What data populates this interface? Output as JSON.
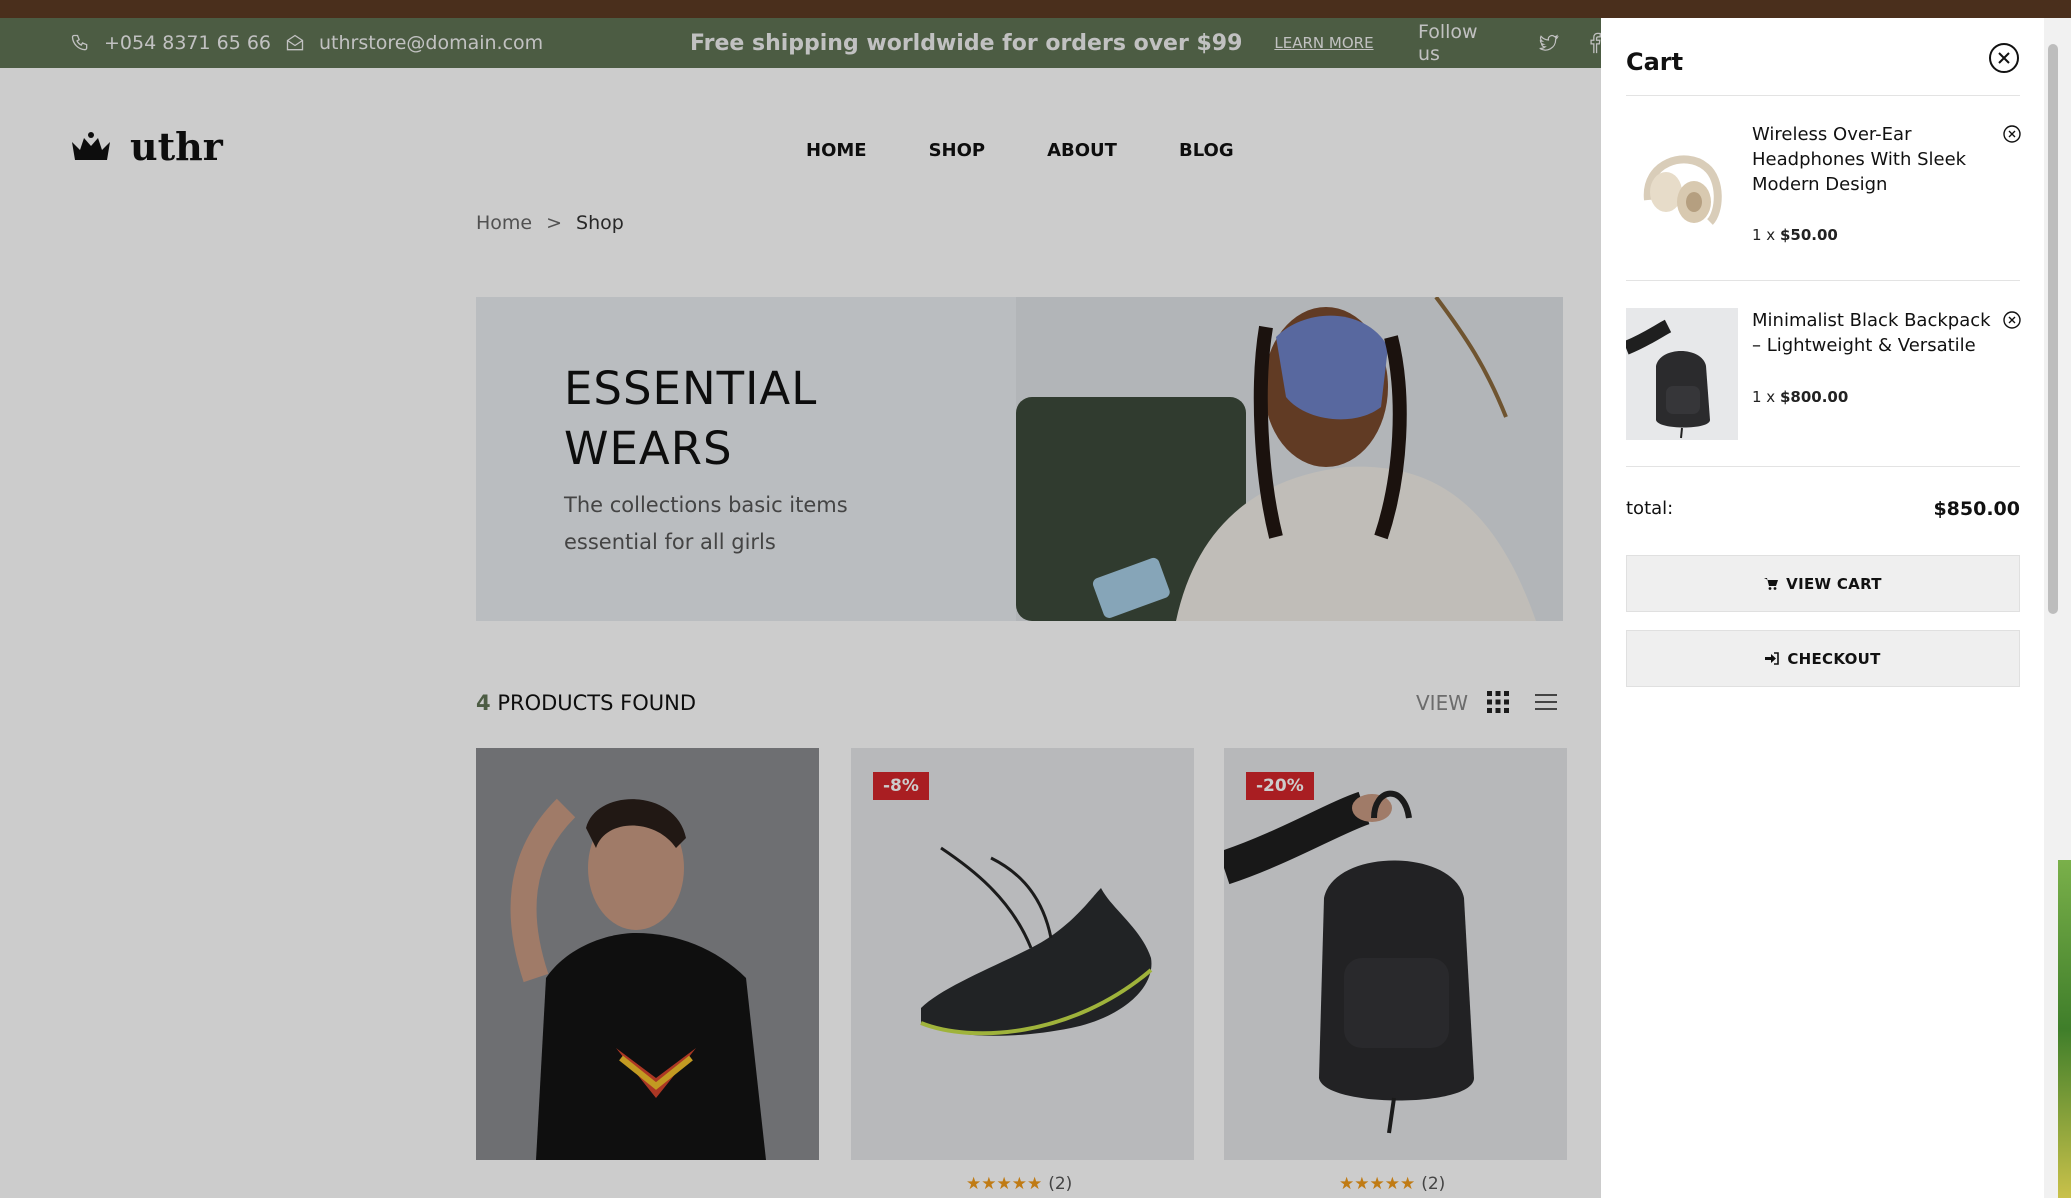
{
  "topbar": {
    "phone": "+054 8371 65 66",
    "email": "uthrstore@domain.com",
    "shipping_text": "Free shipping worldwide for orders over $99",
    "learn_more": "LEARN MORE",
    "follow_us": "Follow us"
  },
  "header": {
    "logo_text": "uthr",
    "nav": [
      "HOME",
      "SHOP",
      "ABOUT",
      "BLOG"
    ]
  },
  "breadcrumb": {
    "home": "Home",
    "sep": ">",
    "current": "Shop"
  },
  "banner": {
    "title_line1": "ESSENTIAL",
    "title_line2": "WEARS",
    "subtitle": "The collections basic items essential for all girls"
  },
  "products": {
    "count": "4",
    "found_label": "PRODUCTS FOUND",
    "view_label": "VIEW",
    "cards": [
      {
        "badge": "",
        "rating_count": ""
      },
      {
        "badge": "-8%",
        "rating_count": "(2)"
      },
      {
        "badge": "-20%",
        "rating_count": "(2)"
      }
    ]
  },
  "cart": {
    "title": "Cart",
    "items": [
      {
        "name": "Wireless Over-Ear Headphones With Sleek Modern Design",
        "qty": "1 x",
        "price": "$50.00"
      },
      {
        "name": "Minimalist Black Backpack – Lightweight & Versatile",
        "qty": "1 x",
        "price": "$800.00"
      }
    ],
    "total_label": "total:",
    "total_value": "$850.00",
    "view_cart": "VIEW CART",
    "checkout": "CHECKOUT"
  },
  "colors": {
    "topbar": "#5f7354",
    "badge": "#d4262b",
    "stars": "#f09a1a"
  }
}
